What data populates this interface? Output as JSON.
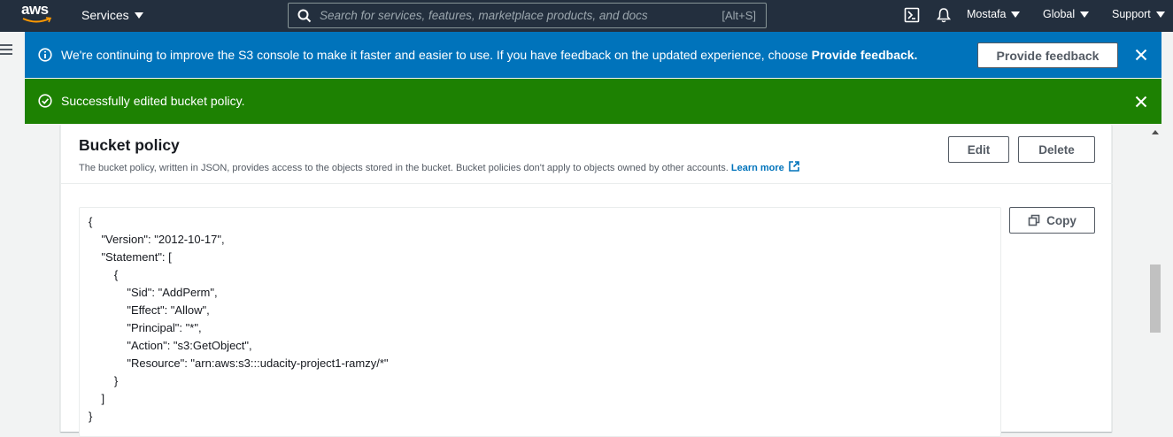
{
  "topnav": {
    "logo_text": "aws",
    "services_label": "Services",
    "search_placeholder": "Search for services, features, marketplace products, and docs",
    "search_shortcut": "[Alt+S]",
    "user_label": "Mostafa",
    "region_label": "Global",
    "support_label": "Support",
    "icons": [
      "terminal-icon",
      "bell-icon"
    ]
  },
  "flash_info": {
    "message_prefix": "We're continuing to improve the S3 console to make it faster and easier to use. If you have feedback on the updated experience, choose ",
    "message_bold": "Provide feedback.",
    "button_label": "Provide feedback",
    "color": "#0073bb"
  },
  "flash_success": {
    "message": "Successfully edited bucket policy.",
    "color": "#1d8102"
  },
  "bucket_policy": {
    "title": "Bucket policy",
    "description": "The bucket policy, written in JSON, provides access to the objects stored in the bucket. Bucket policies don't apply to objects owned by other accounts.",
    "learn_more": "Learn more",
    "edit_label": "Edit",
    "delete_label": "Delete",
    "copy_label": "Copy",
    "policy_json": "{\n    \"Version\": \"2012-10-17\",\n    \"Statement\": [\n        {\n            \"Sid\": \"AddPerm\",\n            \"Effect\": \"Allow\",\n            \"Principal\": \"*\",\n            \"Action\": \"s3:GetObject\",\n            \"Resource\": \"arn:aws:s3:::udacity-project1-ramzy/*\"\n        }\n    ]\n}"
  },
  "colors": {
    "nav_bg": "#232f3e",
    "link": "#0073bb",
    "logo_smile": "#ff9900"
  }
}
